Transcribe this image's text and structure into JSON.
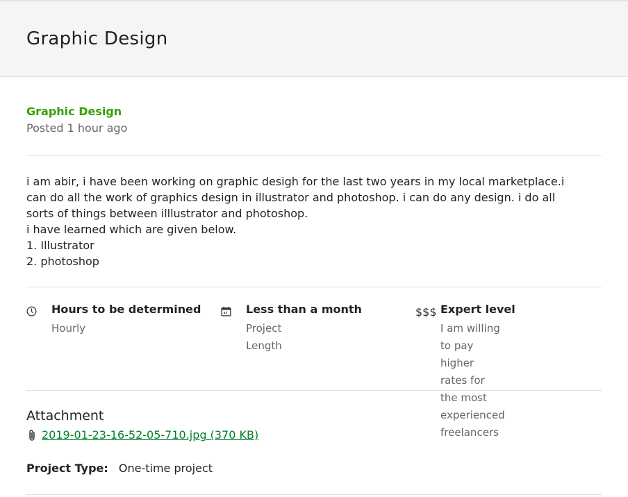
{
  "header": {
    "title": "Graphic Design"
  },
  "job": {
    "category": "Graphic Design",
    "posted": "Posted 1 hour ago",
    "description_lines": [
      "i am abir, i have been working on graphic desigh for the last two years in my local marketplace.i",
      "can do all the work of graphics design in illustrator and photoshop. i can do any design. i do all",
      "sorts of things between illlustrator and photoshop.",
      "i have learned which are given below.",
      "1. Illustrator",
      "2. photoshop"
    ]
  },
  "features": {
    "hours": {
      "icon": "clock-icon",
      "title": "Hours to be determined",
      "sub": "Hourly"
    },
    "length": {
      "icon": "calendar-icon",
      "title": "Less than a month",
      "sub": "Project Length"
    },
    "level": {
      "icon_text": "$$$",
      "title": "Expert level",
      "sub_lines": [
        "I am willing to pay higher",
        "rates for the most",
        "experienced freelancers"
      ]
    }
  },
  "attachment": {
    "heading": "Attachment",
    "file_label": "2019-01-23-16-52-05-710.jpg (370 KB)"
  },
  "project_type": {
    "label": "Project Type:",
    "value": "One-time project"
  },
  "colors": {
    "accent_green": "#37a000",
    "link_green": "#008329",
    "muted": "#656565"
  }
}
